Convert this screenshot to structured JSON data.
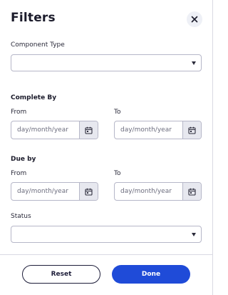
{
  "header": {
    "title": "Filters"
  },
  "component_type": {
    "label": "Component Type",
    "value": ""
  },
  "complete_by": {
    "label": "Complete By",
    "from_label": "From",
    "to_label": "To",
    "from_placeholder": "day/month/year",
    "to_placeholder": "day/month/year"
  },
  "due_by": {
    "label": "Due by",
    "from_label": "From",
    "to_label": "To",
    "from_placeholder": "day/month/year",
    "to_placeholder": "day/month/year"
  },
  "status": {
    "label": "Status",
    "value": ""
  },
  "footer": {
    "reset_label": "Reset",
    "done_label": "Done"
  },
  "colors": {
    "accent": "#1f4bd8",
    "field_border": "#b6b7c8",
    "calendar_button_bg": "#e7e8ef",
    "text": "#1b1b2b"
  }
}
